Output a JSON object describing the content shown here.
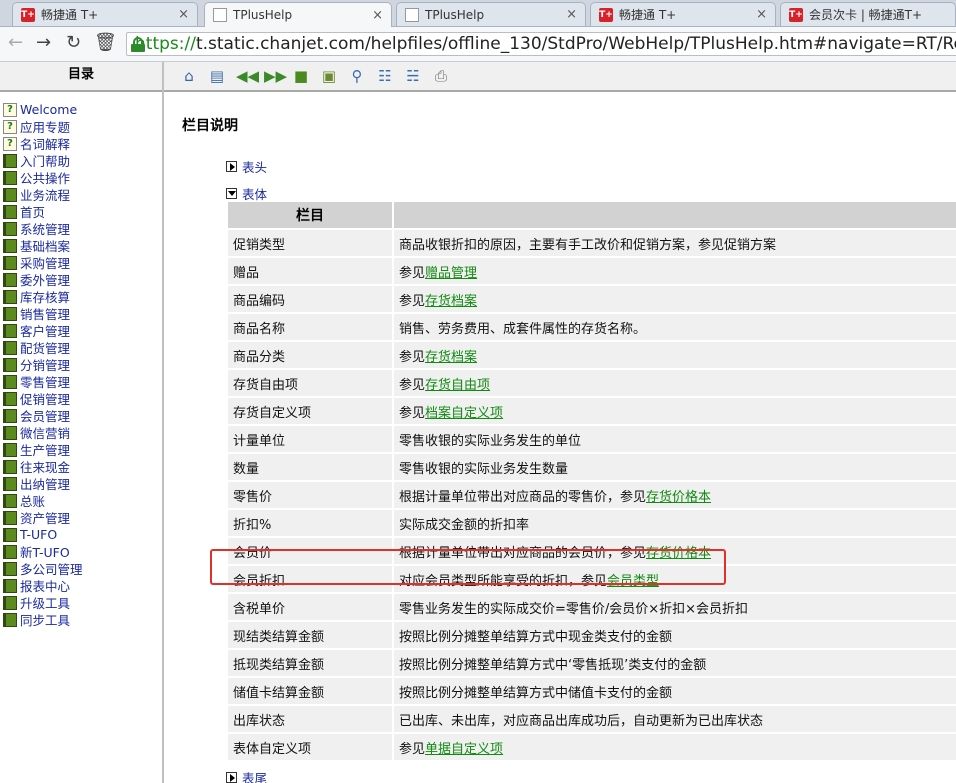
{
  "tabs": [
    {
      "label": "畅捷通 T+",
      "icon": "tplus-logo-icon",
      "active": false
    },
    {
      "label": "TPlusHelp",
      "icon": "page-icon",
      "active": true
    },
    {
      "label": "TPlusHelp",
      "icon": "page-icon",
      "active": false
    },
    {
      "label": "畅捷通 T+",
      "icon": "tplus-logo-icon",
      "active": false
    },
    {
      "label": "会员次卡 | 畅捷通T+",
      "icon": "tplus-logo-icon",
      "active": false
    }
  ],
  "tab_icon_text": "T+",
  "tab_close": "×",
  "address": {
    "protocol": "https://",
    "rest": "t.static.chanjet.com/helpfiles/offline_130/StdPro/WebHelp/TPlusHelp.htm#navigate=RT/Retail.htm"
  },
  "left": {
    "header": "目录",
    "items": [
      {
        "label": "Welcome",
        "icon": "help-page-icon"
      },
      {
        "label": "应用专题",
        "icon": "help-page-icon"
      },
      {
        "label": "名词解释",
        "icon": "help-page-icon"
      },
      {
        "label": "入门帮助",
        "icon": "book-icon"
      },
      {
        "label": "公共操作",
        "icon": "book-icon"
      },
      {
        "label": "业务流程",
        "icon": "book-icon"
      },
      {
        "label": "首页",
        "icon": "book-icon"
      },
      {
        "label": "系统管理",
        "icon": "book-icon"
      },
      {
        "label": "基础档案",
        "icon": "book-icon"
      },
      {
        "label": "采购管理",
        "icon": "book-icon"
      },
      {
        "label": "委外管理",
        "icon": "book-icon"
      },
      {
        "label": "库存核算",
        "icon": "book-icon"
      },
      {
        "label": "销售管理",
        "icon": "book-icon"
      },
      {
        "label": "客户管理",
        "icon": "book-icon"
      },
      {
        "label": "配货管理",
        "icon": "book-icon"
      },
      {
        "label": "分销管理",
        "icon": "book-icon"
      },
      {
        "label": "零售管理",
        "icon": "book-icon"
      },
      {
        "label": "促销管理",
        "icon": "book-icon"
      },
      {
        "label": "会员管理",
        "icon": "book-icon"
      },
      {
        "label": "微信营销",
        "icon": "book-icon"
      },
      {
        "label": "生产管理",
        "icon": "book-icon"
      },
      {
        "label": "往来现金",
        "icon": "book-icon"
      },
      {
        "label": "出纳管理",
        "icon": "book-icon"
      },
      {
        "label": "总账",
        "icon": "book-icon"
      },
      {
        "label": "资产管理",
        "icon": "book-icon"
      },
      {
        "label": "T-UFO",
        "icon": "book-icon"
      },
      {
        "label": "新T-UFO",
        "icon": "book-icon"
      },
      {
        "label": "多公司管理",
        "icon": "book-icon"
      },
      {
        "label": "报表中心",
        "icon": "book-icon"
      },
      {
        "label": "升级工具",
        "icon": "book-icon"
      },
      {
        "label": "同步工具",
        "icon": "book-icon"
      }
    ]
  },
  "toolbar": [
    "home-icon",
    "monitor-icon",
    "prev-icon",
    "next-icon",
    "book-icon",
    "document-icon",
    "search-icon",
    "sync-toc-icon",
    "collapse-icon",
    "print-icon"
  ],
  "content": {
    "title": "栏目说明",
    "section_header": "表头",
    "section_body": "表体",
    "section_footer": "表尾",
    "col_header_1": "栏目",
    "col_header_2": "",
    "rows": [
      {
        "name": "促销类型",
        "text": "商品收银折扣的原因，主要有手工改价和促销方案，参见促销方案",
        "link": ""
      },
      {
        "name": "赠品",
        "text": "参见",
        "link": "赠品管理"
      },
      {
        "name": "商品编码",
        "text": "参见",
        "link": "存货档案"
      },
      {
        "name": "商品名称",
        "text": "销售、劳务费用、成套件属性的存货名称。",
        "link": ""
      },
      {
        "name": "商品分类",
        "text": "参见",
        "link": "存货档案"
      },
      {
        "name": "存货自由项",
        "text": "参见",
        "link": "存货自由项"
      },
      {
        "name": "存货自定义项",
        "text": "参见",
        "link": "档案自定义项"
      },
      {
        "name": "计量单位",
        "text": "零售收银的实际业务发生的单位",
        "link": ""
      },
      {
        "name": "数量",
        "text": "零售收银的实际业务发生数量",
        "link": ""
      },
      {
        "name": "零售价",
        "text": "根据计量单位带出对应商品的零售价，参见",
        "link": "存货价格本"
      },
      {
        "name": "折扣%",
        "text": "实际成交金额的折扣率",
        "link": ""
      },
      {
        "name": "会员价",
        "text": "根据计量单位带出对应商品的会员价，参见",
        "link": "存货价格本"
      },
      {
        "name": "会员折扣",
        "text": "对应会员类型所能享受的折扣，参见",
        "link": "会员类型"
      },
      {
        "name": "含税单价",
        "text": "零售业务发生的实际成交价=零售价/会员价×折扣×会员折扣",
        "link": ""
      },
      {
        "name": "现结类结算金额",
        "text": "按照比例分摊整单结算方式中现金类支付的金额",
        "link": ""
      },
      {
        "name": "抵现类结算金额",
        "text": "按照比例分摊整单结算方式中‘零售抵现’类支付的金额",
        "link": ""
      },
      {
        "name": "储值卡结算金额",
        "text": "按照比例分摊整单结算方式中储值卡支付的金额",
        "link": ""
      },
      {
        "name": "出库状态",
        "text": "已出库、未出库，对应商品出库成功后，自动更新为已出库状态",
        "link": ""
      },
      {
        "name": "表体自定义项",
        "text": "参见",
        "link": "单据自定义项"
      }
    ]
  },
  "colors": {
    "highlight": "#e0302a",
    "link": "#128a12",
    "toc_link": "#1a2aa0"
  }
}
